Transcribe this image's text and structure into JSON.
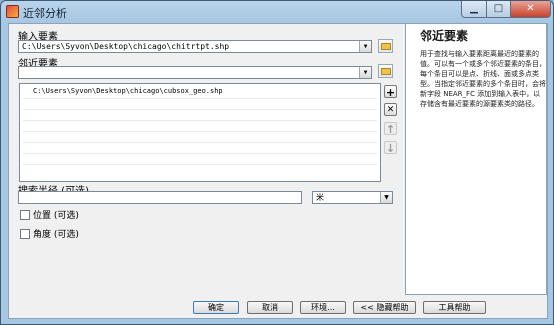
{
  "window": {
    "title": "近邻分析"
  },
  "input_features": {
    "label": "输入要素",
    "value": "C:\\Users\\Syvon\\Desktop\\chicago\\chitrtpt.shp"
  },
  "near_features": {
    "label": "邻近要素",
    "value": "",
    "list": [
      "C:\\Users\\Syvon\\Desktop\\chicago\\cubsox_geo.shp"
    ]
  },
  "search_radius": {
    "label": "搜索半径 (可选)",
    "value": "",
    "unit": "米"
  },
  "location": {
    "label": "位置 (可选)",
    "checked": false
  },
  "angle": {
    "label": "角度 (可选)",
    "checked": false
  },
  "side_buttons": {
    "add": "+",
    "remove": "✕",
    "up": "↑",
    "down": "↓"
  },
  "help": {
    "title": "邻近要素",
    "text": "用于查找与输入要素距离最近的要素的值。可以有一个或多个邻近要素的条目，每个条目可以是点、折线、面或多点类型。当指定邻近要素的多个条目时，会将新字段 NEAR_FC 添加到输入表中，以存储含有最近要素的源要素类的路径。"
  },
  "buttons": {
    "ok": "确定",
    "cancel": "取消",
    "env": "环境...",
    "hide_help": "<< 隐藏帮助",
    "tool_help": "工具帮助"
  },
  "colors": {
    "accent": "#3a78c0",
    "frame": "#a7c6e2",
    "close": "#c7432c"
  }
}
